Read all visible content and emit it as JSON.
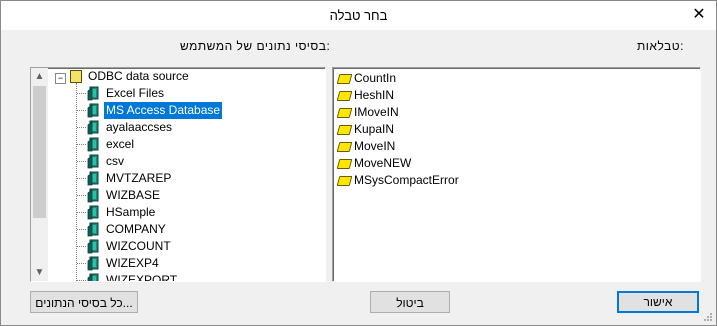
{
  "window": {
    "title": "בחר טבלה"
  },
  "labels": {
    "tables": "טבלאות:",
    "user_databases": "בסיסי נתונים של המשתמש:"
  },
  "tables": [
    "CountIn",
    "HeshIN",
    "IMoveIN",
    "KupaIN",
    "MoveIN",
    "MoveNEW",
    "MSysCompactError"
  ],
  "tree": {
    "root": "ODBC data source",
    "items": [
      "Excel Files",
      "MS Access Database",
      "ayalaaccses",
      "excel",
      "csv",
      "MVTZAREP",
      "WIZBASE",
      "HSample",
      "COMPANY",
      "WIZCOUNT",
      "WIZEXP4",
      "WIZEXPORT"
    ],
    "selected": "MS Access Database"
  },
  "buttons": {
    "ok": "אישור",
    "cancel": "ביטול",
    "all_databases": "כל בסיסי הנתונים..."
  },
  "icons": {
    "close": "close-icon",
    "table": "table-icon",
    "database": "database-icon",
    "folder": "odbc-folder-icon"
  },
  "colors": {
    "selection": "#0078d7",
    "table_icon": "#ffe600",
    "db_icon": "#1a8a7a"
  }
}
